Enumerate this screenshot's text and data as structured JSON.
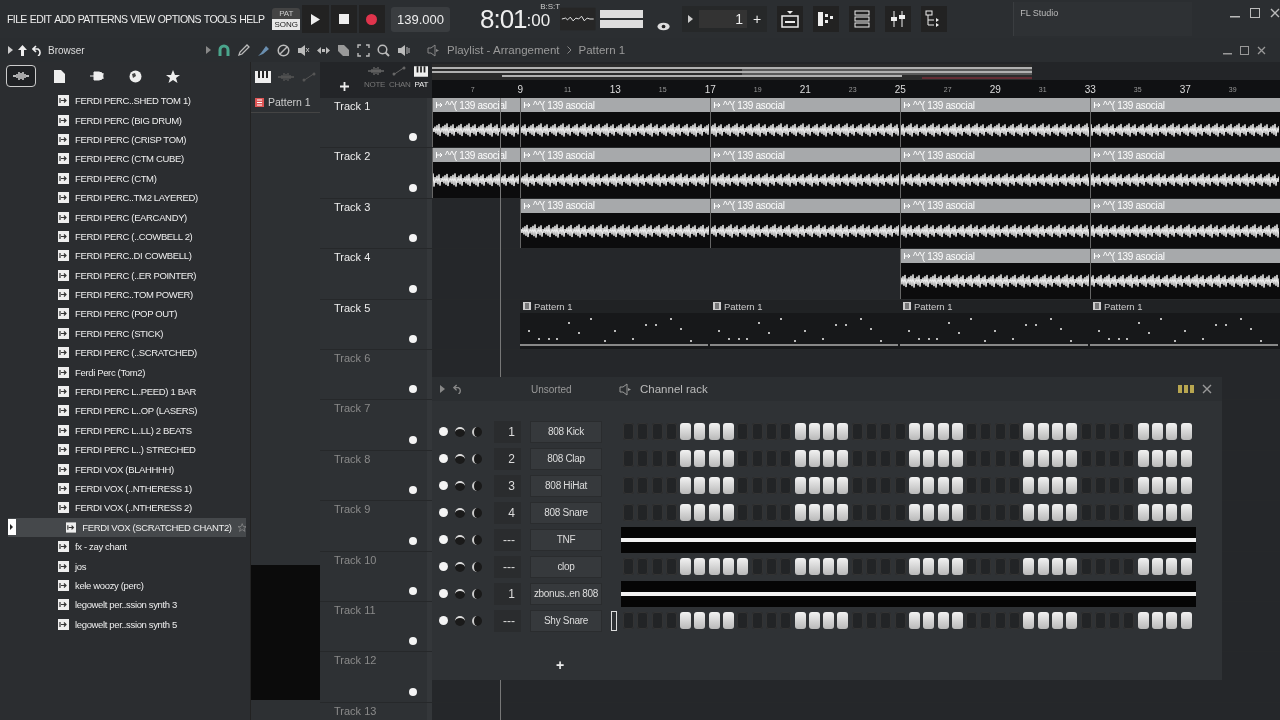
{
  "menu": [
    "FILE",
    "EDIT",
    "ADD",
    "PATTERNS",
    "VIEW",
    "OPTIONS",
    "TOOLS",
    "HELP"
  ],
  "transport": {
    "modes": [
      {
        "label": "PAT",
        "selected": false
      },
      {
        "label": "SONG",
        "selected": true
      }
    ],
    "tempo": "139.000",
    "time": "8:01",
    "time_sub": ":00",
    "time_format": "B:S:T",
    "pattern_number": "1",
    "pattern_add": "+"
  },
  "hint_panel": {
    "title": "FL Studio"
  },
  "browser": {
    "title": "Browser",
    "tabs": [
      {
        "kind": "audio",
        "selected": true
      },
      {
        "kind": "files",
        "selected": false
      },
      {
        "kind": "plugin",
        "selected": false
      },
      {
        "kind": "web",
        "selected": false
      },
      {
        "kind": "favorites",
        "selected": false
      }
    ],
    "items": [
      {
        "label": "FERDI PERC..SHED TOM 1)",
        "selected": false
      },
      {
        "label": "FERDI PERC (BIG DRUM)",
        "selected": false
      },
      {
        "label": "FERDI PERC (CRISP TOM)",
        "selected": false
      },
      {
        "label": "FERDI PERC (CTM CUBE)",
        "selected": false
      },
      {
        "label": "FERDI PERC (CTM)",
        "selected": false
      },
      {
        "label": "FERDI PERC..TM2 LAYERED)",
        "selected": false
      },
      {
        "label": "FERDI PERC (EARCANDY)",
        "selected": false
      },
      {
        "label": "FERDI PERC (..COWBELL 2)",
        "selected": false
      },
      {
        "label": "FERDI PERC..DI COWBELL)",
        "selected": false
      },
      {
        "label": "FERDI PERC (..ER POINTER)",
        "selected": false
      },
      {
        "label": "FERDI PERC..TOM POWER)",
        "selected": false
      },
      {
        "label": "FERDI PERC (POP OUT)",
        "selected": false
      },
      {
        "label": "FERDI PERC (STICK)",
        "selected": false
      },
      {
        "label": "FERDI PERC (..SCRATCHED)",
        "selected": false
      },
      {
        "label": "Ferdi Perc (Tom2)",
        "selected": false
      },
      {
        "label": "FERDI PERC L..PEED) 1 BAR",
        "selected": false
      },
      {
        "label": "FERDI PERC L..OP (LASERS)",
        "selected": false
      },
      {
        "label": "FERDI PERC L..LL) 2 BEATS",
        "selected": false
      },
      {
        "label": "FERDI PERC L..) STRECHED",
        "selected": false
      },
      {
        "label": "FERDI VOX (BLAHHHH)",
        "selected": false
      },
      {
        "label": "FERDI VOX (..NTHERESS 1)",
        "selected": false
      },
      {
        "label": "FERDI VOX (..NTHERESS 2)",
        "selected": false
      },
      {
        "label": "FERDI VOX (SCRATCHED CHANT2)",
        "selected": true
      },
      {
        "label": "fx - zay chant",
        "selected": false
      },
      {
        "label": "jos",
        "selected": false
      },
      {
        "label": "kele woozy (perc)",
        "selected": false
      },
      {
        "label": "legowelt per..ssion synth 3",
        "selected": false
      },
      {
        "label": "legowelt per..ssion synth 5",
        "selected": false
      }
    ]
  },
  "pattern_list": {
    "items": [
      "Pattern 1"
    ]
  },
  "playlist": {
    "title": "Playlist - Arrangement",
    "pattern": "Pattern 1",
    "tool_labels": [
      "NOTE",
      "CHAN",
      "PAT"
    ],
    "ruler": [
      "7",
      "9",
      "11",
      "13",
      "15",
      "17",
      "19",
      "21",
      "23",
      "25",
      "27",
      "29",
      "31",
      "33",
      "35",
      "37",
      "39"
    ],
    "tracks": [
      {
        "name": "Track 1",
        "on": true,
        "slots": [
          {
            "kind": "audio",
            "label": "^^( 139 asocial"
          },
          {
            "kind": "audio",
            "label": "^^( 139 asocial"
          },
          {
            "kind": "audio",
            "label": "^^( 139 asocial"
          },
          {
            "kind": "audio",
            "label": "^^( 139 asocial"
          },
          {
            "kind": "audio",
            "label": "^^( 139 asocial"
          }
        ]
      },
      {
        "name": "Track 2",
        "on": true,
        "slots": [
          {
            "kind": "audio",
            "label": "^^( 139 asocial"
          },
          {
            "kind": "audio",
            "label": "^^( 139 asocial"
          },
          {
            "kind": "audio",
            "label": "^^( 139 asocial"
          },
          {
            "kind": "audio",
            "label": "^^( 139 asocial"
          },
          {
            "kind": "audio",
            "label": "^^( 139 asocial"
          }
        ]
      },
      {
        "name": "Track 3",
        "on": true,
        "slots": [
          {
            "kind": "empty"
          },
          {
            "kind": "audio",
            "label": "^^( 139 asocial"
          },
          {
            "kind": "audio",
            "label": "^^( 139 asocial"
          },
          {
            "kind": "audio",
            "label": "^^( 139 asocial"
          },
          {
            "kind": "audio",
            "label": "^^( 139 asocial"
          }
        ]
      },
      {
        "name": "Track 4",
        "on": true,
        "slots": [
          {
            "kind": "empty"
          },
          {
            "kind": "empty"
          },
          {
            "kind": "empty"
          },
          {
            "kind": "audio",
            "label": "^^( 139 asocial"
          },
          {
            "kind": "audio",
            "label": "^^( 139 asocial"
          }
        ]
      },
      {
        "name": "Track 5",
        "on": true,
        "slots": [
          {
            "kind": "empty"
          },
          {
            "kind": "pattern",
            "label": "Pattern 1"
          },
          {
            "kind": "pattern",
            "label": "Pattern 1"
          },
          {
            "kind": "pattern",
            "label": "Pattern 1"
          },
          {
            "kind": "pattern",
            "label": "Pattern 1"
          }
        ]
      },
      {
        "name": "Track 6",
        "on": true
      },
      {
        "name": "Track 7",
        "on": true
      },
      {
        "name": "Track 8",
        "on": true
      },
      {
        "name": "Track 9",
        "on": true
      },
      {
        "name": "Track 10",
        "on": true
      },
      {
        "name": "Track 11",
        "on": true
      },
      {
        "name": "Track 12",
        "on": true
      },
      {
        "name": "Track 13"
      }
    ]
  },
  "channel_rack": {
    "filter": "Unsorted",
    "title": "Channel rack",
    "add": "+",
    "channels": [
      {
        "kind": "steps",
        "number": "1",
        "name": "808 Kick",
        "on": true,
        "selected": false,
        "steps": [
          false,
          false,
          false,
          false,
          true,
          true,
          true,
          true,
          false,
          false,
          false,
          false,
          true,
          true,
          true,
          true,
          false,
          false,
          false,
          false,
          true,
          true,
          true,
          true,
          false,
          false,
          false,
          false,
          true,
          true,
          true,
          true,
          false,
          false,
          false,
          false,
          true,
          true,
          true,
          true
        ]
      },
      {
        "kind": "steps",
        "number": "2",
        "name": "808 Clap",
        "on": true,
        "selected": false,
        "steps": [
          false,
          false,
          false,
          false,
          true,
          true,
          true,
          true,
          false,
          false,
          false,
          false,
          true,
          true,
          true,
          true,
          false,
          false,
          false,
          false,
          true,
          true,
          true,
          true,
          false,
          false,
          false,
          false,
          true,
          true,
          true,
          true,
          false,
          false,
          false,
          false,
          true,
          true,
          true,
          true
        ]
      },
      {
        "kind": "steps",
        "number": "3",
        "name": "808 HiHat",
        "on": true,
        "selected": false,
        "steps": [
          false,
          false,
          false,
          false,
          true,
          true,
          true,
          true,
          false,
          false,
          false,
          false,
          true,
          true,
          true,
          true,
          false,
          false,
          false,
          false,
          true,
          true,
          true,
          true,
          false,
          false,
          false,
          false,
          true,
          true,
          true,
          true,
          false,
          false,
          false,
          false,
          true,
          true,
          true,
          true
        ]
      },
      {
        "kind": "steps",
        "number": "4",
        "name": "808 Snare",
        "on": true,
        "selected": false,
        "steps": [
          false,
          false,
          false,
          false,
          true,
          true,
          true,
          true,
          false,
          false,
          false,
          false,
          true,
          true,
          true,
          true,
          false,
          false,
          false,
          false,
          true,
          true,
          true,
          true,
          false,
          false,
          false,
          false,
          true,
          true,
          true,
          true,
          false,
          false,
          false,
          false,
          true,
          true,
          true,
          true
        ]
      },
      {
        "kind": "pianoroll",
        "number": "---",
        "name": "TNF",
        "on": true,
        "selected": false
      },
      {
        "kind": "steps",
        "number": "---",
        "name": "clop",
        "on": true,
        "selected": false,
        "steps": [
          false,
          false,
          false,
          false,
          true,
          true,
          true,
          true,
          true,
          false,
          false,
          false,
          true,
          true,
          true,
          true,
          false,
          false,
          false,
          false,
          true,
          true,
          true,
          true,
          false,
          false,
          false,
          false,
          true,
          true,
          true,
          true,
          false,
          false,
          false,
          false,
          true,
          true,
          true,
          true
        ]
      },
      {
        "kind": "pianoroll",
        "number": "1",
        "name": "zbonus..en 808",
        "on": true,
        "selected": false
      },
      {
        "kind": "steps",
        "number": "---",
        "name": "Shy Snare",
        "on": true,
        "selected": true,
        "steps": [
          false,
          false,
          false,
          false,
          true,
          true,
          true,
          true,
          false,
          false,
          false,
          false,
          true,
          true,
          true,
          true,
          false,
          false,
          false,
          false,
          true,
          true,
          true,
          true,
          false,
          false,
          false,
          false,
          true,
          true,
          true,
          true,
          false,
          false,
          false,
          false,
          true,
          true,
          true,
          true
        ]
      }
    ]
  }
}
